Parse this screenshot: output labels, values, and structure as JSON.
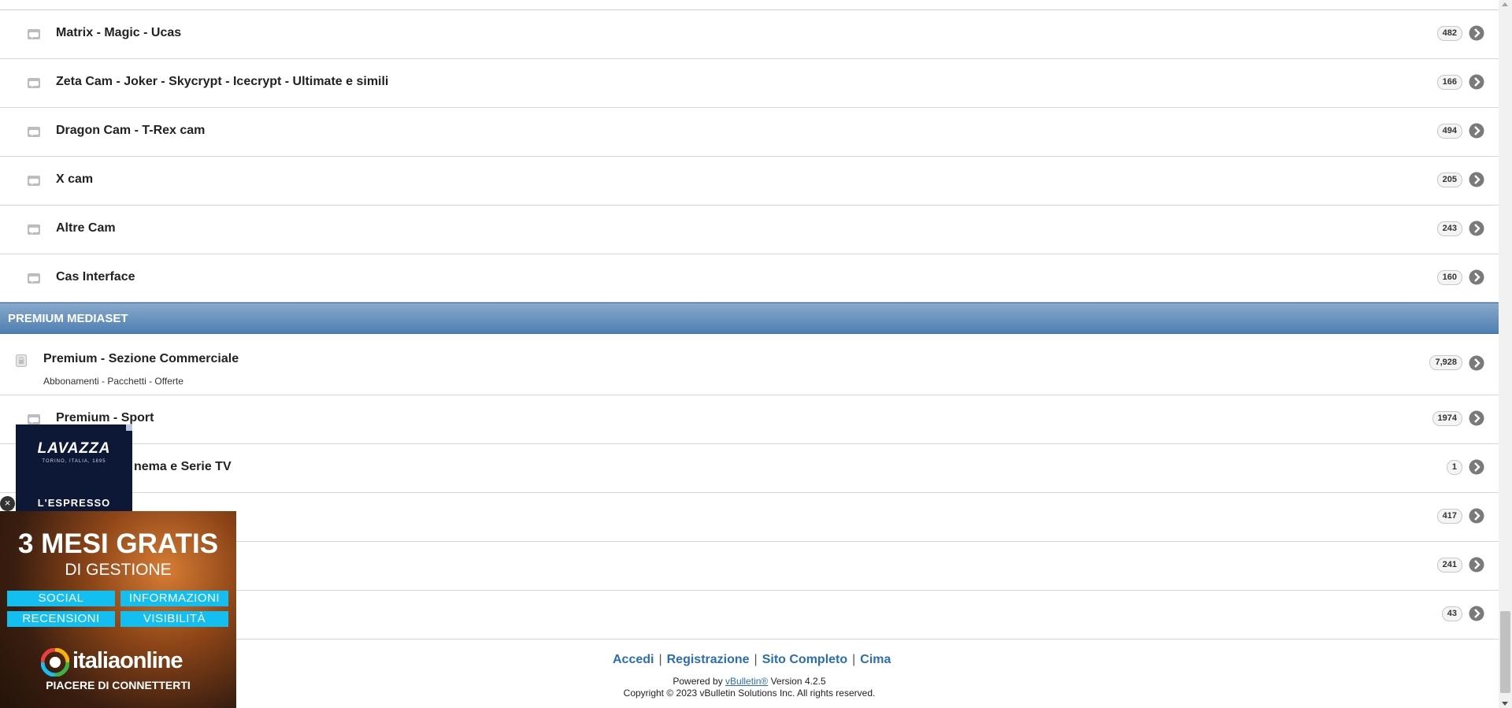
{
  "forums_top": [
    {
      "title": "Matrix - Magic - Ucas",
      "count": "482"
    },
    {
      "title": "Zeta Cam - Joker - Skycrypt - Icecrypt - Ultimate e simili",
      "count": "166"
    },
    {
      "title": "Dragon Cam - T-Rex cam",
      "count": "494"
    },
    {
      "title": "X cam",
      "count": "205"
    },
    {
      "title": "Altre Cam",
      "count": "243"
    },
    {
      "title": "Cas Interface",
      "count": "160"
    }
  ],
  "section": {
    "title": "PREMIUM MEDIASET"
  },
  "commercial": {
    "title": "Premium - Sezione Commerciale",
    "subtitle": "Abbonamenti - Pacchetti - Offerte",
    "count": "7,928"
  },
  "forums_bottom": [
    {
      "title": "Premium - Sport",
      "count": "1974"
    },
    {
      "title": "nema e Serie TV",
      "count": "1"
    },
    {
      "title": "",
      "count": "417"
    },
    {
      "title": "",
      "count": "241"
    },
    {
      "title": "",
      "count": "43"
    }
  ],
  "footer": {
    "links": [
      "Accedi",
      "Registrazione",
      "Sito Completo",
      "Cima"
    ],
    "powered_prefix": "Powered by ",
    "powered_link": "vBulletin®",
    "powered_suffix": " Version 4.2.5",
    "copyright": "Copyright © 2023 vBulletin Solutions Inc. All rights reserved."
  },
  "ads": {
    "lavazza": {
      "brand": "LAVAZZA",
      "tagline": "TORINO, ITALIA, 1895",
      "text": "L'ESPRESSO"
    },
    "italiaonline": {
      "headline": "3 MESI GRATIS",
      "subheadline": "DI GESTIONE",
      "pills": [
        "SOCIAL",
        "INFORMAZIONI",
        "RECENSIONI",
        "VISIBILITÀ"
      ],
      "logo_text": "italiaonline",
      "slogan": "PIACERE DI CONNETTERTI",
      "pill_color": "#12bff0"
    }
  },
  "colors": {
    "section_header": "#5f8dbd",
    "link": "#2b6db6"
  }
}
